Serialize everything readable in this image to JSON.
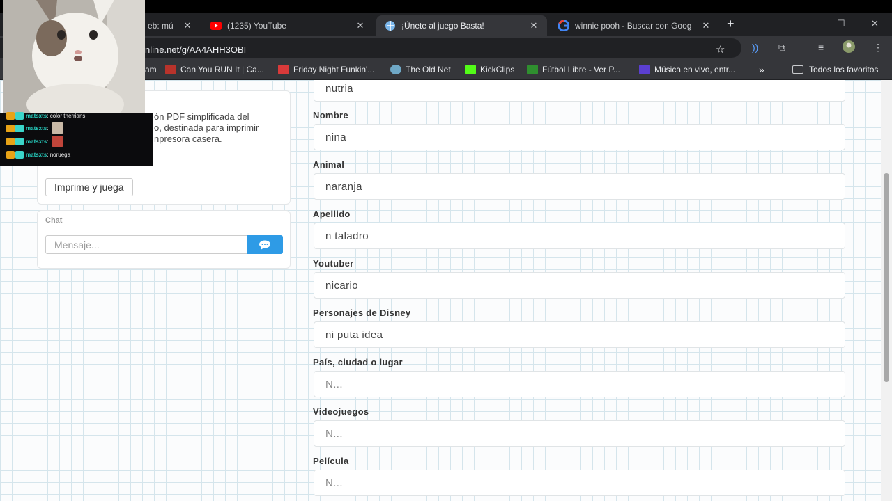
{
  "tabs": [
    {
      "title": "eb: mú",
      "close": "✕"
    },
    {
      "title": "(1235) YouTube",
      "close": "✕"
    },
    {
      "title": "¡Únete al juego Basta!",
      "close": "✕"
    },
    {
      "title": "winnie pooh - Buscar con Goog",
      "close": "✕"
    }
  ],
  "new_tab": "+",
  "window_controls": {
    "minimize": "—",
    "maximize": "☐",
    "close": "✕"
  },
  "address_bar": {
    "url": "nline.net/g/AA4AHH3OBI"
  },
  "bookmarks": [
    {
      "label": "am",
      "icon_color": "#6c6c6c"
    },
    {
      "label": "Can You RUN It | Ca...",
      "icon_color": "#b8332b"
    },
    {
      "label": "Friday Night Funkin'...",
      "icon_color": "#d93a3a"
    },
    {
      "label": "The Old Net",
      "icon_color": "#6fa8c6"
    },
    {
      "label": "KickClips",
      "icon_color": "#53fc18"
    },
    {
      "label": "Fútbol Libre - Ver P...",
      "icon_color": "#2f8f2f"
    },
    {
      "label": "Música en vivo, entr...",
      "icon_color": "#5b3fd1"
    }
  ],
  "bookmarks_overflow": "»",
  "all_bookmarks": "Todos los favoritos",
  "print_panel": {
    "description_lines": [
      "ón PDF simplificada del",
      "o, destinada para imprimir",
      "npresora casera."
    ],
    "button": "Imprime y juega"
  },
  "chat": {
    "title": "Chat",
    "placeholder": "Mensaje...",
    "send_icon": "chat-bubble"
  },
  "categories": [
    {
      "label": "",
      "value": "nutria"
    },
    {
      "label": "Nombre",
      "value": "nina"
    },
    {
      "label": "Animal",
      "value": "naranja"
    },
    {
      "label": "Apellido",
      "value": "n taladro"
    },
    {
      "label": "Youtuber",
      "value": "nicario"
    },
    {
      "label": "Personajes de Disney",
      "value": "ni puta idea"
    },
    {
      "label": "País, ciudad o lugar",
      "value": "N..."
    },
    {
      "label": "Videojuegos",
      "value": "N..."
    },
    {
      "label": "Película",
      "value": "N..."
    }
  ],
  "stream_chat": [
    {
      "user": "matsxts",
      "message": "color therrians"
    },
    {
      "user": "matsxts",
      "message": ""
    },
    {
      "user": "matsxts",
      "message": ""
    },
    {
      "user": "matsxts",
      "message": "noruega"
    }
  ],
  "colors": {
    "accent": "#2e9be6",
    "twitch_name": "#26d0c0"
  }
}
